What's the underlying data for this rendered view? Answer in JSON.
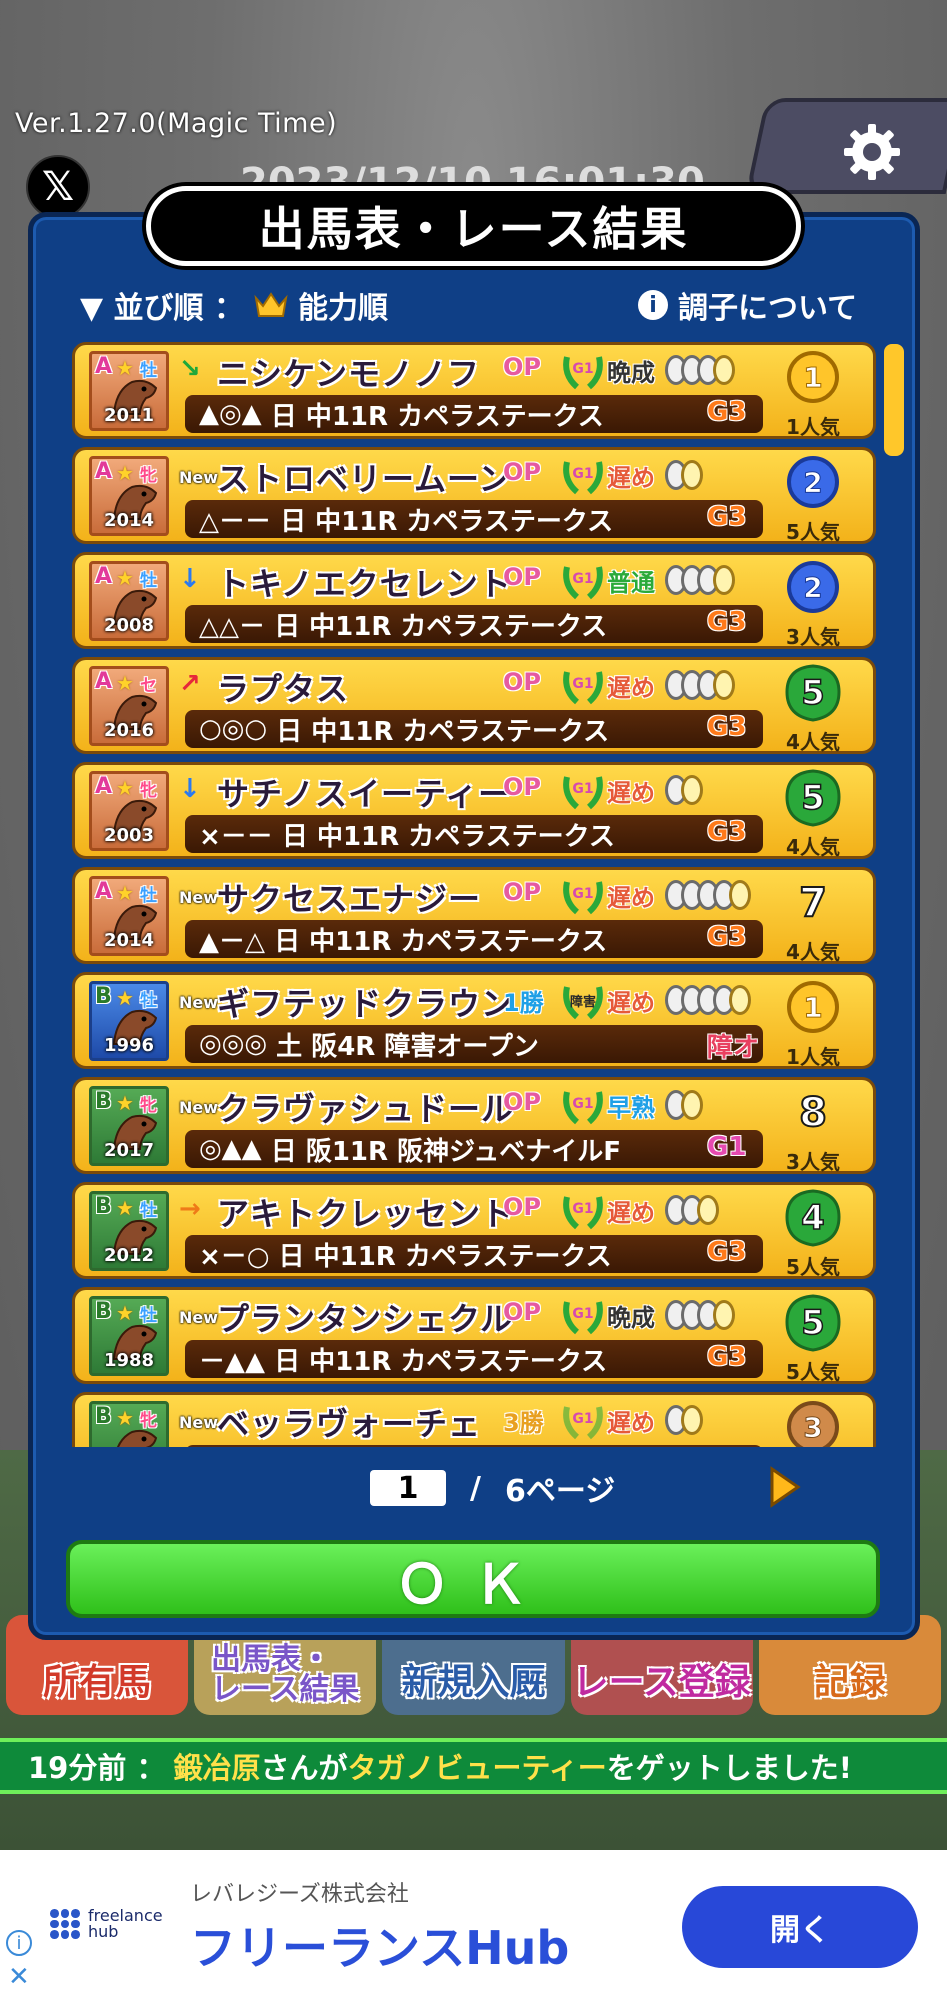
{
  "version": "Ver.1.27.0(Magic Time)",
  "clock_partial": "2023/12/10 16:01:30",
  "modal": {
    "title": "出馬表・レース結果",
    "sort_label": "▼ 並び順 ：",
    "sort_value": "能力順",
    "condition_link": "調子について"
  },
  "horses": [
    {
      "grade": "A",
      "sex": "牡",
      "year": "2011",
      "trend": "↘",
      "name": "ニシケンモノノフ",
      "cls": "OP",
      "laurel": "G1",
      "growth": "晩成",
      "shoes": 4,
      "marks": "▲◎▲",
      "day": "日",
      "venue": "中11R",
      "race": "カペラステークス",
      "race_grade": "G3",
      "rank": "1",
      "pop": "1人気"
    },
    {
      "grade": "A",
      "sex": "牝",
      "year": "2014",
      "trend": "New",
      "name": "ストロベリームーン",
      "cls": "OP",
      "laurel": "G1",
      "growth": "遅め",
      "shoes": 2,
      "marks": "△－－",
      "day": "日",
      "venue": "中11R",
      "race": "カペラステークス",
      "race_grade": "G3",
      "rank": "2",
      "pop": "5人気"
    },
    {
      "grade": "A",
      "sex": "牡",
      "year": "2008",
      "trend": "↓",
      "name": "トキノエクセレント",
      "cls": "OP",
      "laurel": "G1",
      "growth": "普通",
      "shoes": 4,
      "marks": "△△－",
      "day": "日",
      "venue": "中11R",
      "race": "カペラステークス",
      "race_grade": "G3",
      "rank": "2",
      "pop": "3人気"
    },
    {
      "grade": "A",
      "sex": "セ",
      "year": "2016",
      "trend": "↗",
      "name": "ラプタス",
      "cls": "OP",
      "laurel": "G1",
      "growth": "遅め",
      "shoes": 4,
      "marks": "○◎○",
      "day": "日",
      "venue": "中11R",
      "race": "カペラステークス",
      "race_grade": "G3",
      "rank": "5",
      "pop": "4人気"
    },
    {
      "grade": "A",
      "sex": "牝",
      "year": "2003",
      "trend": "↓",
      "name": "サチノスイーティー",
      "cls": "OP",
      "laurel": "G1",
      "growth": "遅め",
      "shoes": 2,
      "marks": "×－－",
      "day": "日",
      "venue": "中11R",
      "race": "カペラステークス",
      "race_grade": "G3",
      "rank": "5",
      "pop": "4人気"
    },
    {
      "grade": "A",
      "sex": "牡",
      "year": "2014",
      "trend": "New",
      "name": "サクセスエナジー",
      "cls": "OP",
      "laurel": "G1",
      "growth": "遅め",
      "shoes": 5,
      "marks": "▲－△",
      "day": "日",
      "venue": "中11R",
      "race": "カペラステークス",
      "race_grade": "G3",
      "rank": "7",
      "pop": "4人気"
    },
    {
      "grade": "B",
      "sex": "牡",
      "year": "1996",
      "trend": "New",
      "name": "ギフテッドクラウン",
      "cls": "1勝",
      "laurel": "障害",
      "growth": "遅め",
      "shoes": 5,
      "marks": "◎◎◎",
      "day": "土",
      "venue": "阪4R",
      "race": "障害オープン",
      "race_grade": "障オ",
      "rank": "1",
      "pop": "1人気"
    },
    {
      "grade": "B",
      "sex": "牝",
      "year": "2017",
      "trend": "New",
      "name": "クラヴァシュドール",
      "cls": "OP",
      "laurel": "G1",
      "growth": "早熟",
      "shoes": 2,
      "marks": "◎▲▲",
      "day": "日",
      "venue": "阪11R",
      "race": "阪神ジュベナイルF",
      "race_grade": "G1",
      "rank": "8",
      "pop": "3人気"
    },
    {
      "grade": "B",
      "sex": "牡",
      "year": "2012",
      "trend": "→",
      "name": "アキトクレッセント",
      "cls": "OP",
      "laurel": "G1",
      "growth": "遅め",
      "shoes": 3,
      "marks": "×－○",
      "day": "日",
      "venue": "中11R",
      "race": "カペラステークス",
      "race_grade": "G3",
      "rank": "4",
      "pop": "5人気"
    },
    {
      "grade": "B",
      "sex": "牡",
      "year": "1988",
      "trend": "New",
      "name": "プランタンシェクル",
      "cls": "OP",
      "laurel": "G1",
      "growth": "晩成",
      "shoes": 4,
      "marks": "－▲▲",
      "day": "日",
      "venue": "中11R",
      "race": "カペラステークス",
      "race_grade": "G3",
      "rank": "5",
      "pop": "5人気"
    },
    {
      "grade": "B",
      "sex": "牝",
      "year": "",
      "trend": "New",
      "name": "ベッラヴォーチェ",
      "cls": "3勝",
      "laurel": "G1",
      "growth": "遅め",
      "shoes": 2,
      "marks": "",
      "day": "",
      "venue": "",
      "race": "",
      "race_grade": "",
      "rank": "3",
      "pop": ""
    }
  ],
  "pager": {
    "current": "1",
    "separator": "/",
    "total": "6ページ"
  },
  "ok_label": "ＯＫ",
  "nav": [
    "所有馬",
    "出馬表・\nレース結果",
    "新規入厩",
    "レース登録",
    "記録"
  ],
  "ticker": {
    "time": "19分前 ：",
    "user": "鍛冶原",
    "mid": "さんが",
    "horse": "タガノビューティー",
    "tail": "をゲットしました!"
  },
  "ad": {
    "company": "レバレジーズ株式会社",
    "title": "フリーランスHub",
    "logo": "freelance hub",
    "open": "開く"
  },
  "colors": {
    "modal": "#0f3f86",
    "row": "#ffd94a",
    "ok": "#2fc01a",
    "ticker": "#0e8a3a",
    "ad_button": "#2848d8"
  }
}
